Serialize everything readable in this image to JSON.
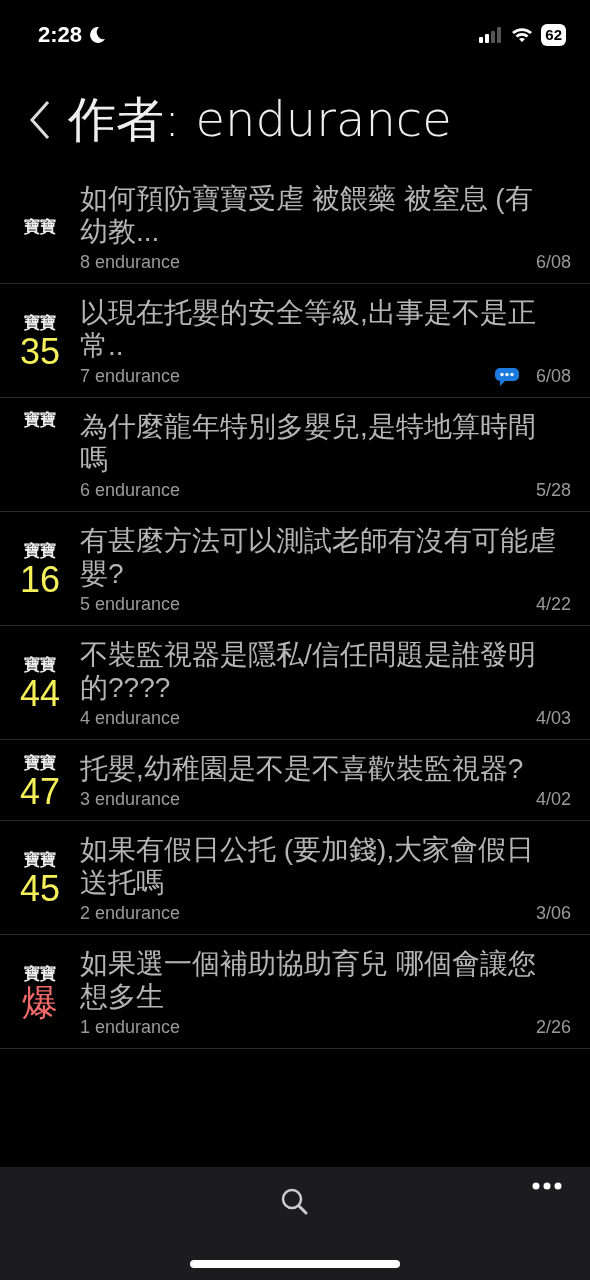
{
  "status_bar": {
    "time": "2:28",
    "battery": "62"
  },
  "header": {
    "title": "作者: endurance"
  },
  "posts": [
    {
      "badge": "寶寶",
      "title": "如何預防寶寶受虐 被餵藥 被窒息 (有幼教...",
      "floor": "8",
      "author": "endurance",
      "date": "6/08",
      "comment": false
    },
    {
      "badge": "寶寶",
      "score": "35",
      "color": "#f5f05a",
      "title": "以現在托嬰的安全等級,出事是不是正常..",
      "floor": "7",
      "author": "endurance",
      "date": "6/08",
      "comment": true
    },
    {
      "badge": "寶寶",
      "title": "為什麼龍年特別多嬰兒,是特地算時間嗎",
      "floor": "6",
      "author": "endurance",
      "date": "5/28",
      "comment": false
    },
    {
      "badge": "寶寶",
      "score": "16",
      "color": "#f5f05a",
      "title": "有甚麼方法可以測試老師有沒有可能虐嬰?",
      "floor": "5",
      "author": "endurance",
      "date": "4/22",
      "comment": false
    },
    {
      "badge": "寶寶",
      "score": "44",
      "color": "#f5f05a",
      "title": "不裝監視器是隱私/信任問題是誰發明的????",
      "floor": "4",
      "author": "endurance",
      "date": "4/03",
      "comment": false
    },
    {
      "badge": "寶寶",
      "score": "47",
      "color": "#f5f05a",
      "title": "托嬰,幼稚園是不是不喜歡裝監視器?",
      "floor": "3",
      "author": "endurance",
      "date": "4/02",
      "comment": false
    },
    {
      "badge": "寶寶",
      "score": "45",
      "color": "#f5f05a",
      "title": "如果有假日公托 (要加錢),大家會假日送托嗎",
      "floor": "2",
      "author": "endurance",
      "date": "3/06",
      "comment": false
    },
    {
      "badge": "寶寶",
      "score": "爆",
      "color": "#f26a6a",
      "title": "如果選一個補助協助育兒 哪個會讓您想多生",
      "floor": "1",
      "author": "endurance",
      "date": "2/26",
      "comment": false
    }
  ]
}
